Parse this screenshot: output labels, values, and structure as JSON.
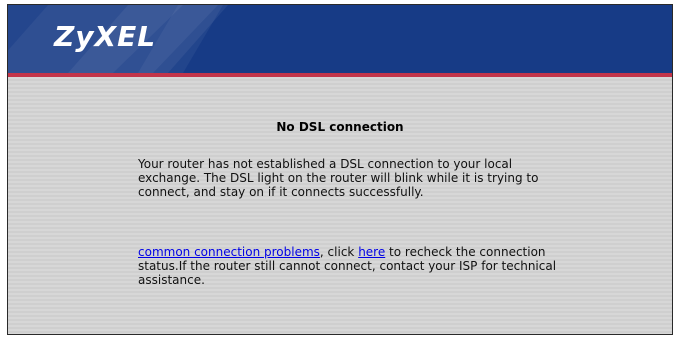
{
  "header": {
    "logo": "ZyXEL"
  },
  "main": {
    "title": "No DSL connection",
    "paragraph1": "Your router has not established a DSL connection to your local exchange. The DSL light on the router will blink while it is trying to connect, and stay on if it connects successfully.",
    "paragraph2": {
      "link1": "common connection problems",
      "text1": ", click ",
      "link2": "here",
      "text2": " to recheck the connection status.If the router still cannot connect, contact your ISP for technical assistance."
    }
  },
  "colors": {
    "header_bg": "#173b86",
    "header_stripe": "#c3354a",
    "body_bg": "#d3d3d3",
    "link": "#0000e6"
  }
}
